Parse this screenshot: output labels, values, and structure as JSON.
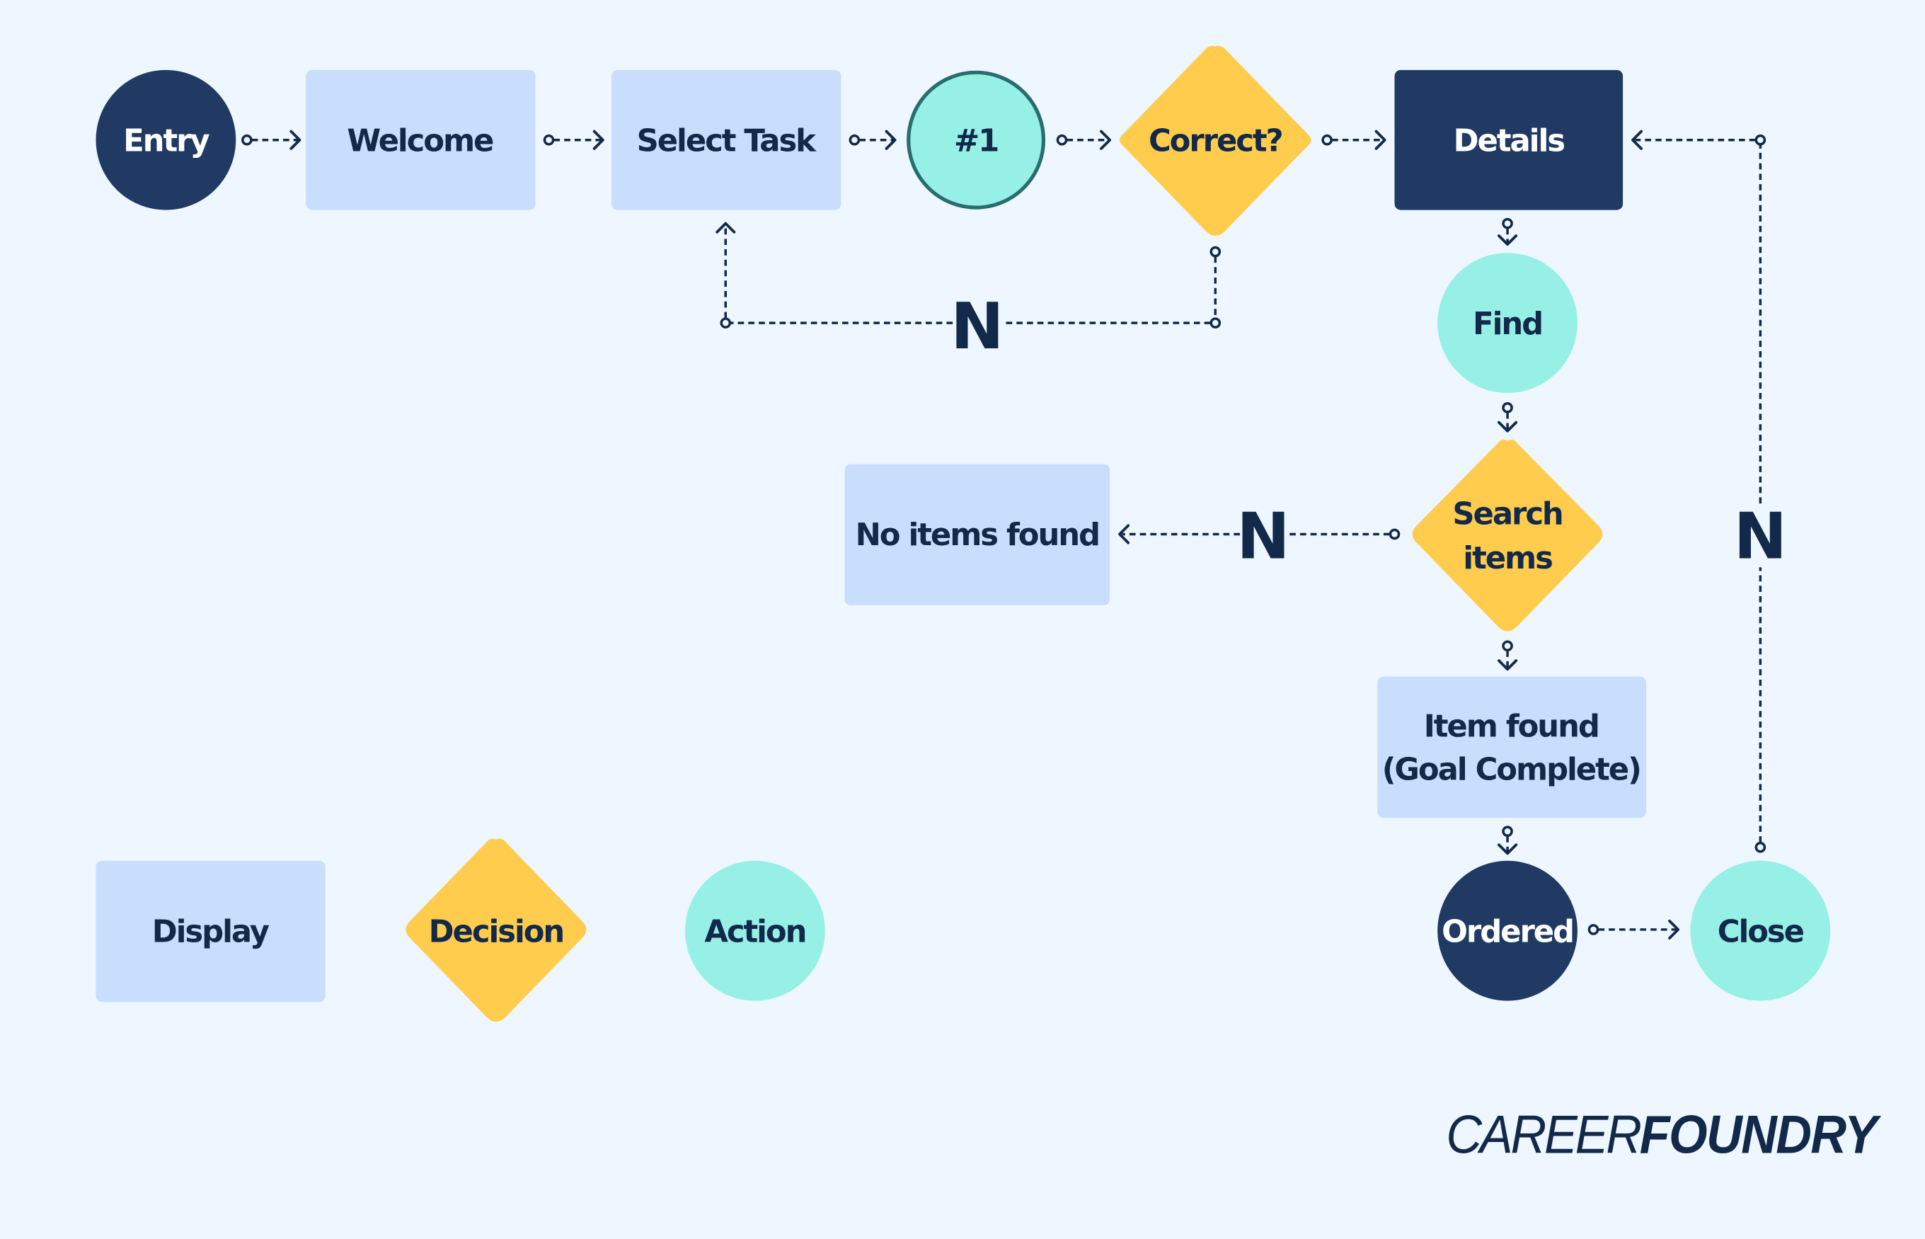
{
  "colors": {
    "background": "#eef6ff",
    "display": "#c9defc",
    "decision": "#ffcc4d",
    "action": "#96f0e6",
    "terminal": "#203a63",
    "ink": "#12294a",
    "action_outline": "#286e6e"
  },
  "nodes": {
    "entry": "Entry",
    "welcome": "Welcome",
    "select_task": "Select Task",
    "step1": "#1",
    "correct": "Correct?",
    "details": "Details",
    "find": "Find",
    "search_line1": "Search",
    "search_line2": "items",
    "no_items": "No items found",
    "item_found_line1": "Item found",
    "item_found_line2": "(Goal Complete)",
    "ordered": "Ordered",
    "close": "Close"
  },
  "edge_labels": {
    "correct_no": "N",
    "search_no": "N",
    "close_no": "N"
  },
  "legend": {
    "display": "Display",
    "decision": "Decision",
    "action": "Action"
  },
  "logo": {
    "part1": "CAREER",
    "part2": "FOUNDRY"
  }
}
